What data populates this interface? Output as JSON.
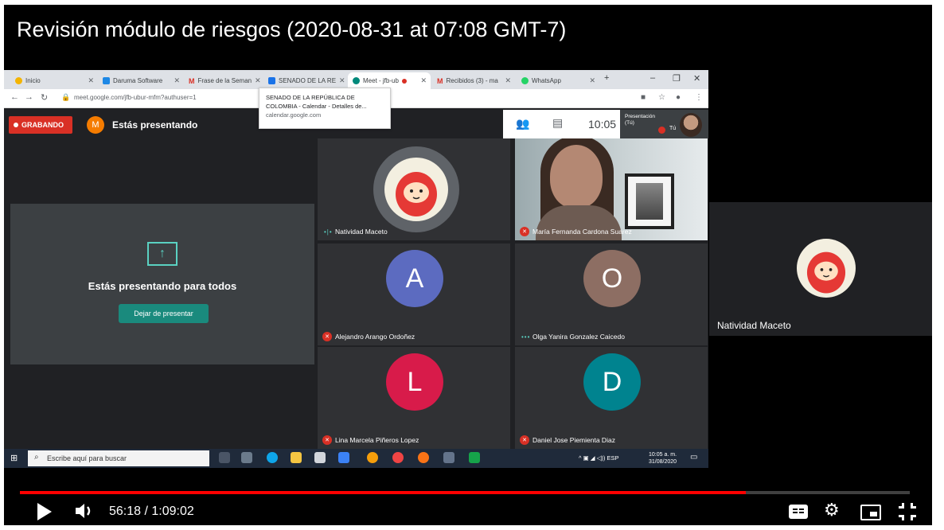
{
  "video": {
    "title": "Revisión módulo de riesgos (2020-08-31 at 07:08 GMT-7)"
  },
  "browser": {
    "tabs": [
      {
        "label": "Inicio"
      },
      {
        "label": "Daruma Software"
      },
      {
        "label": "Frase de la Seman"
      },
      {
        "label": "SENADO DE LA RE"
      },
      {
        "label": "Meet - jfb-ub"
      },
      {
        "label": "Recibidos (3) - ma"
      },
      {
        "label": "WhatsApp"
      }
    ],
    "url": "meet.google.com/jfb-ubur-mfm?authuser=1",
    "tooltip": {
      "line1": "SENADO DE LA REPÚBLICA DE",
      "line2": "COLOMBIA - Calendar - Detalles de...",
      "domain": "calendar.google.com"
    }
  },
  "meet": {
    "recording_label": "GRABANDO",
    "presenter_initial": "M",
    "presenting_label": "Estás presentando",
    "clock": "10:05",
    "self_view": {
      "line1": "Presentación",
      "line2": "(Tú)",
      "you": "Tú"
    },
    "present_tile": {
      "message": "Estás presentando para todos",
      "stop_button": "Dejar de presentar"
    },
    "participants": [
      {
        "name": "Natividad Maceto"
      },
      {
        "name": "María Fernanda Cardona Suarez"
      },
      {
        "name": "Alejandro Arango Ordoñez",
        "initial": "A",
        "color": "#5c6bc0"
      },
      {
        "name": "Olga Yanira Gonzalez Caicedo",
        "initial": "O",
        "color": "#8d6e63"
      },
      {
        "name": "Lina Marcela Piñeros Lopez",
        "initial": "L",
        "color": "#d81b4a"
      },
      {
        "name": "Daniel Jose Piemienta Diaz",
        "initial": "D",
        "color": "#00838f"
      }
    ],
    "side_panel_name": "Natividad Maceto"
  },
  "taskbar": {
    "search_placeholder": "Escribe aquí para buscar",
    "language": "ESP",
    "time": "10:05 a. m.",
    "date": "31/08/2020"
  },
  "player": {
    "current_time": "56:18",
    "separator": " / ",
    "duration": "1:09:02",
    "progress_fraction": 0.8156,
    "accent_color": "#ff0000"
  }
}
